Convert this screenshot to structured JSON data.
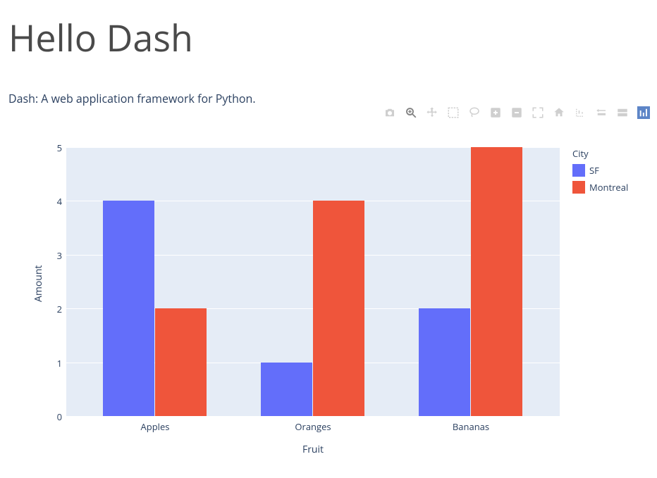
{
  "header": {
    "title": "Hello Dash",
    "subtitle": "Dash: A web application framework for Python."
  },
  "toolbar": {
    "icons": [
      "camera-icon",
      "zoom-icon",
      "pan-icon",
      "box-select-icon",
      "lasso-select-icon",
      "zoom-in-icon",
      "zoom-out-icon",
      "autoscale-icon",
      "reset-axes-icon",
      "spike-lines-icon",
      "closest-hover-icon",
      "compare-hover-icon",
      "plotly-logo-icon"
    ]
  },
  "chart_data": {
    "type": "bar",
    "categories": [
      "Apples",
      "Oranges",
      "Bananas"
    ],
    "series": [
      {
        "name": "SF",
        "values": [
          4,
          1,
          2
        ],
        "color": "#636efa"
      },
      {
        "name": "Montreal",
        "values": [
          2,
          4,
          5
        ],
        "color": "#ef553b"
      }
    ],
    "xlabel": "Fruit",
    "ylabel": "Amount",
    "ylim": [
      0,
      5
    ],
    "yticks": [
      0,
      1,
      2,
      3,
      4,
      5
    ],
    "legend_title": "City",
    "title": ""
  }
}
